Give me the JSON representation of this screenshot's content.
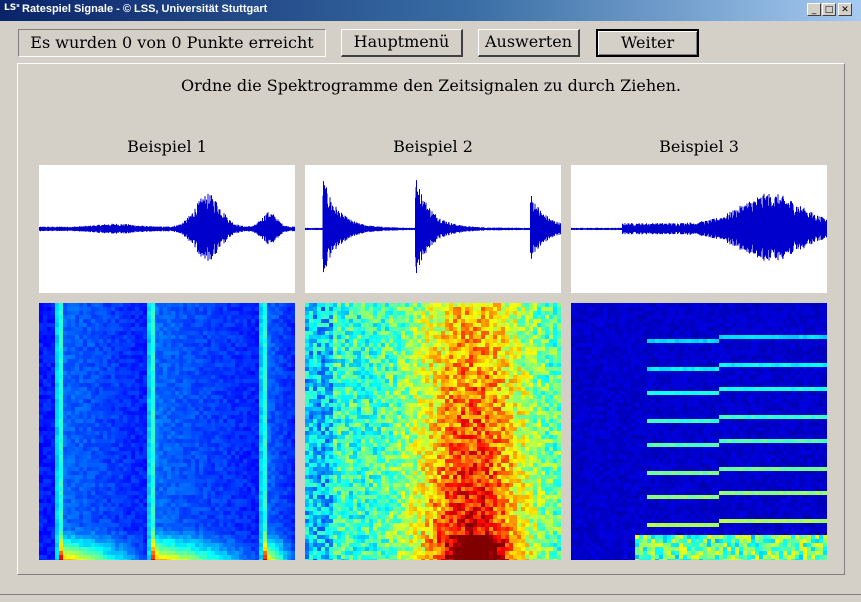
{
  "window": {
    "logo": "LSˢ",
    "title": "Ratespiel Signale - © LSS, Universität Stuttgart",
    "minimize": "_",
    "maximize": "□",
    "close": "✕"
  },
  "toolbar": {
    "score": "Es wurden 0 von 0 Punkte erreicht",
    "main_menu": "Hauptmenü",
    "evaluate": "Auswerten",
    "next": "Weiter"
  },
  "instruction": "Ordne die Spektrogramme den Zeitsignalen zu durch Ziehen.",
  "examples": [
    {
      "label": "Beispiel 1"
    },
    {
      "label": "Beispiel 2"
    },
    {
      "label": "Beispiel 3"
    }
  ],
  "colors": {
    "waveform": "#0000cc",
    "spectrogram_low": "#00008f",
    "spectrogram_high": "#ff2000"
  }
}
